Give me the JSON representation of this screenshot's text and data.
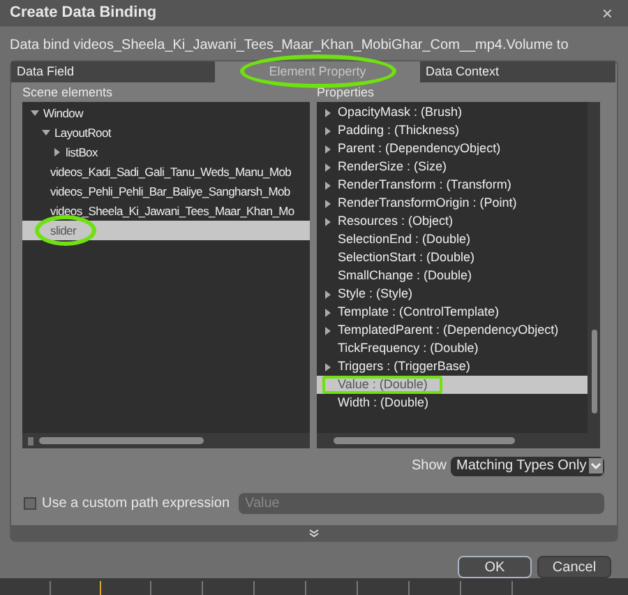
{
  "window": {
    "title": "Create Data Binding",
    "close": "×"
  },
  "description": "Data bind videos_Sheela_Ki_Jawani_Tees_Maar_Khan_MobiGhar_Com__mp4.Volume to",
  "tabs": [
    {
      "label": "Data Field",
      "selected": false
    },
    {
      "label": "Element Property",
      "selected": true,
      "annotated": true
    },
    {
      "label": "Data Context",
      "selected": false
    }
  ],
  "scene_elements": {
    "heading": "Scene elements",
    "tree": [
      {
        "label": "Window",
        "expanded": true,
        "selected": false,
        "children": [
          {
            "label": "LayoutRoot",
            "expanded": true,
            "selected": false,
            "children": [
              {
                "label": "listBox",
                "expanded": false,
                "selected": false
              },
              {
                "label": "videos_Kadi_Sadi_Gali_Tanu_Weds_Manu_Mob",
                "selected": false
              },
              {
                "label": "videos_Pehli_Pehli_Bar_Baliye_Sangharsh_Mob",
                "selected": false
              },
              {
                "label": "videos_Sheela_Ki_Jawani_Tees_Maar_Khan_Mo",
                "selected": false
              },
              {
                "label": "slider",
                "selected": true,
                "annotated": true
              }
            ]
          }
        ]
      }
    ]
  },
  "properties": {
    "heading": "Properties",
    "items": [
      {
        "label": "OpacityMask : (Brush)",
        "expandable": true,
        "selected": false
      },
      {
        "label": "Padding : (Thickness)",
        "expandable": true,
        "selected": false
      },
      {
        "label": "Parent : (DependencyObject)",
        "expandable": true,
        "selected": false
      },
      {
        "label": "RenderSize : (Size)",
        "expandable": true,
        "selected": false
      },
      {
        "label": "RenderTransform : (Transform)",
        "expandable": true,
        "selected": false
      },
      {
        "label": "RenderTransformOrigin : (Point)",
        "expandable": true,
        "selected": false
      },
      {
        "label": "Resources : (Object)",
        "expandable": true,
        "selected": false
      },
      {
        "label": "SelectionEnd : (Double)",
        "expandable": false,
        "selected": false
      },
      {
        "label": "SelectionStart : (Double)",
        "expandable": false,
        "selected": false
      },
      {
        "label": "SmallChange : (Double)",
        "expandable": false,
        "selected": false
      },
      {
        "label": "Style : (Style)",
        "expandable": true,
        "selected": false
      },
      {
        "label": "Template : (ControlTemplate)",
        "expandable": true,
        "selected": false
      },
      {
        "label": "TemplatedParent : (DependencyObject)",
        "expandable": true,
        "selected": false
      },
      {
        "label": "TickFrequency : (Double)",
        "expandable": false,
        "selected": false
      },
      {
        "label": "Triggers : (TriggerBase)",
        "expandable": true,
        "selected": false
      },
      {
        "label": "Value : (Double)",
        "expandable": false,
        "selected": true,
        "annotated": true
      },
      {
        "label": "Width : (Double)",
        "expandable": false,
        "selected": false
      }
    ]
  },
  "show": {
    "label": "Show",
    "value": "Matching Types Only"
  },
  "custom_path": {
    "label": "Use a custom path expression",
    "checked": false,
    "placeholder": "Value"
  },
  "buttons": [
    {
      "label": "OK",
      "default": true
    },
    {
      "label": "Cancel",
      "default": false
    }
  ]
}
